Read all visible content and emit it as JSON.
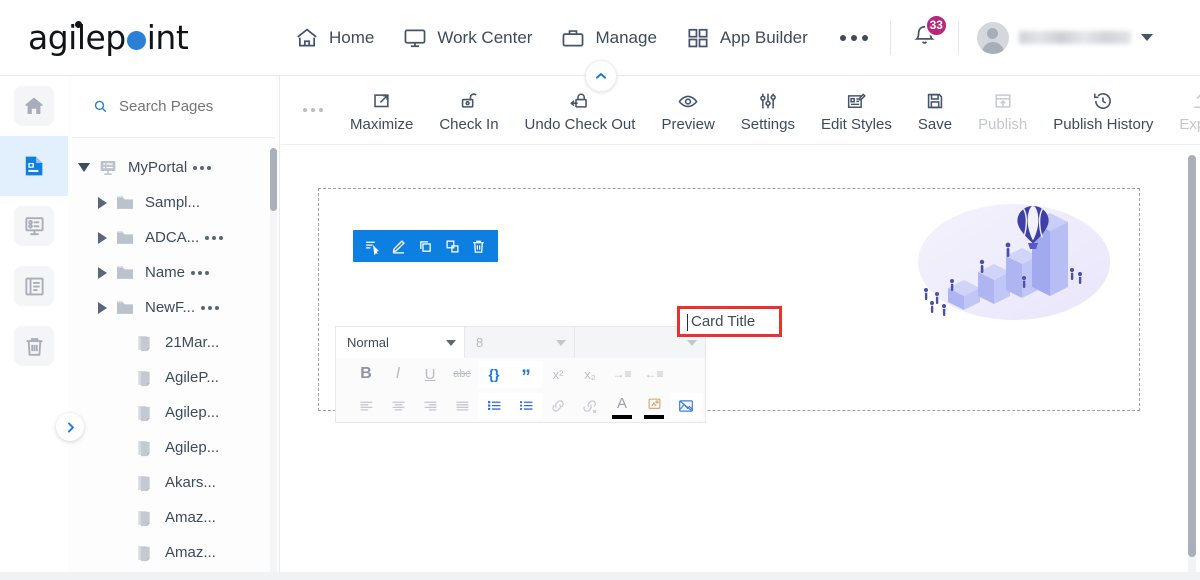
{
  "brand": {
    "name": "agilepoint",
    "dot_color": "#2b7fd4"
  },
  "topnav": {
    "items": [
      {
        "label": "Home",
        "icon": "home-icon"
      },
      {
        "label": "Work Center",
        "icon": "monitor-icon"
      },
      {
        "label": "Manage",
        "icon": "briefcase-icon"
      },
      {
        "label": "App Builder",
        "icon": "grid-icon"
      }
    ],
    "more_label": "",
    "notifications": {
      "count": "33",
      "badge_color": "#b5287b"
    },
    "user": {
      "name": "",
      "caret": "chevron-down-icon"
    }
  },
  "rail": {
    "items": [
      {
        "name": "home",
        "icon": "home-icon",
        "active": false
      },
      {
        "name": "pages",
        "icon": "page-document-icon",
        "active": true
      },
      {
        "name": "forms",
        "icon": "form-list-icon",
        "active": false
      },
      {
        "name": "reports",
        "icon": "report-icon",
        "active": false
      },
      {
        "name": "recycle-bin",
        "icon": "trash-icon",
        "active": false
      }
    ],
    "expand_icon": "chevron-right-icon"
  },
  "pages_panel": {
    "search": {
      "placeholder": "Search Pages",
      "value": "",
      "icon": "search-icon"
    },
    "tree": [
      {
        "label": "MyPortal",
        "icon": "portal-icon",
        "arrow": "open",
        "dots": true,
        "indent": 0
      },
      {
        "label": "Sampl...",
        "icon": "folder-icon",
        "arrow": "closed",
        "dots": false,
        "indent": 1
      },
      {
        "label": "ADCA...",
        "icon": "folder-icon",
        "arrow": "closed",
        "dots": true,
        "indent": 1
      },
      {
        "label": "Name",
        "icon": "folder-icon",
        "arrow": "closed",
        "dots": true,
        "indent": 1
      },
      {
        "label": "NewF...",
        "icon": "folder-icon",
        "arrow": "closed",
        "dots": true,
        "indent": 1
      },
      {
        "label": "21Mar...",
        "icon": "page-icon",
        "arrow": "none",
        "dots": false,
        "indent": 2
      },
      {
        "label": "AgileP...",
        "icon": "page-icon",
        "arrow": "none",
        "dots": false,
        "indent": 2
      },
      {
        "label": "Agilep...",
        "icon": "page-icon",
        "arrow": "none",
        "dots": false,
        "indent": 2
      },
      {
        "label": "Agilep...",
        "icon": "page-icon",
        "arrow": "none",
        "dots": false,
        "indent": 2
      },
      {
        "label": "Akars...",
        "icon": "page-icon",
        "arrow": "none",
        "dots": false,
        "indent": 2
      },
      {
        "label": "Amaz...",
        "icon": "page-icon",
        "arrow": "none",
        "dots": false,
        "indent": 2
      },
      {
        "label": "Amaz...",
        "icon": "page-icon",
        "arrow": "none",
        "dots": false,
        "indent": 2
      }
    ]
  },
  "action_bar": {
    "overflow_icon": "ellipsis-icon",
    "items": [
      {
        "label": "Maximize",
        "icon": "maximize-icon",
        "disabled": false
      },
      {
        "label": "Check In",
        "icon": "unlock-icon",
        "disabled": false
      },
      {
        "label": "Undo Check Out",
        "icon": "lock-undo-icon",
        "disabled": false
      },
      {
        "label": "Preview",
        "icon": "eye-icon",
        "disabled": false
      },
      {
        "label": "Settings",
        "icon": "sliders-icon",
        "disabled": false
      },
      {
        "label": "Edit Styles",
        "icon": "edit-styles-icon",
        "disabled": false
      },
      {
        "label": "Save",
        "icon": "save-disk-icon",
        "disabled": false
      },
      {
        "label": "Publish",
        "icon": "publish-icon",
        "disabled": true
      },
      {
        "label": "Publish History",
        "icon": "history-clock-icon",
        "disabled": false
      },
      {
        "label": "Export",
        "icon": "upload-icon",
        "disabled": true
      }
    ],
    "collapse_icon": "chevron-up-icon"
  },
  "canvas": {
    "float_toolbar": {
      "background": "#0d7fe0",
      "buttons": [
        {
          "name": "select-element-icon"
        },
        {
          "name": "edit-pencil-icon"
        },
        {
          "name": "copy-icon"
        },
        {
          "name": "duplicate-icon"
        },
        {
          "name": "delete-trash-icon"
        }
      ]
    },
    "illustration": {
      "name": "isometric-bar-chart-balloon-illustration"
    },
    "card_title": {
      "value": "Card Title",
      "border_color": "#e8322b"
    }
  },
  "rte_toolbar": {
    "selects": [
      {
        "name": "format-select",
        "value": "Normal",
        "enabled": true
      },
      {
        "name": "font-size-select",
        "value": "8",
        "enabled": false
      },
      {
        "name": "font-family-select",
        "value": "",
        "enabled": false
      }
    ],
    "row2": [
      {
        "name": "bold-button",
        "glyph": "B",
        "style": "dark-bold"
      },
      {
        "name": "italic-button",
        "glyph": "I",
        "style": "dim-italic"
      },
      {
        "name": "underline-button",
        "glyph": "U",
        "style": "dim-underline"
      },
      {
        "name": "strikethrough-button",
        "glyph": "abc",
        "style": "dim-strike"
      },
      {
        "name": "code-block-button",
        "glyph": "{}",
        "style": "blue"
      },
      {
        "name": "blockquote-button",
        "glyph": "”",
        "style": "blue"
      },
      {
        "name": "superscript-button",
        "glyph": "x²",
        "style": "dim"
      },
      {
        "name": "subscript-button",
        "glyph": "x₂",
        "style": "dim"
      },
      {
        "name": "indent-button",
        "glyph": "→≡",
        "style": "dim"
      },
      {
        "name": "outdent-button",
        "glyph": "←≡",
        "style": "dim"
      }
    ],
    "row3": [
      {
        "name": "align-left-button",
        "style": "dim"
      },
      {
        "name": "align-center-button",
        "style": "dim"
      },
      {
        "name": "align-right-button",
        "style": "dim"
      },
      {
        "name": "align-justify-button",
        "style": "dim"
      },
      {
        "name": "ordered-list-button",
        "style": "blue"
      },
      {
        "name": "bullet-list-button",
        "style": "blue"
      },
      {
        "name": "insert-link-button",
        "style": "dim"
      },
      {
        "name": "remove-link-button",
        "style": "dim"
      },
      {
        "name": "text-color-button",
        "style": "color-a"
      },
      {
        "name": "highlight-color-button",
        "style": "color-hl"
      },
      {
        "name": "insert-image-button",
        "style": "blue"
      }
    ]
  }
}
